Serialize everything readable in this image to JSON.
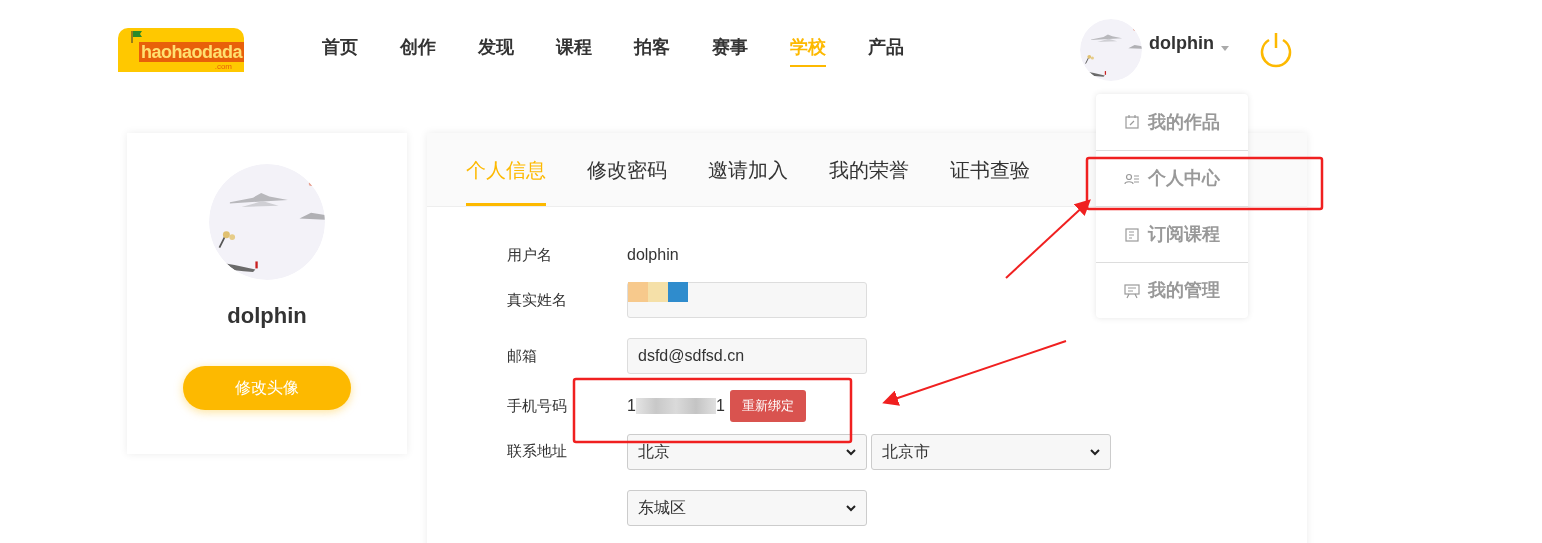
{
  "logo": {
    "text": "haohaodada",
    "suffix": ".com"
  },
  "nav": [
    {
      "label": "首页",
      "selected": false
    },
    {
      "label": "创作",
      "selected": false
    },
    {
      "label": "发现",
      "selected": false
    },
    {
      "label": "课程",
      "selected": false
    },
    {
      "label": "拍客",
      "selected": false
    },
    {
      "label": "赛事",
      "selected": false
    },
    {
      "label": "学校",
      "selected": true
    },
    {
      "label": "产品",
      "selected": false
    }
  ],
  "user": {
    "name": "dolphin"
  },
  "user_menu": {
    "expanded": true,
    "items": [
      {
        "label": "我的作品",
        "kind": "works",
        "selected": false
      },
      {
        "label": "个人中心",
        "kind": "profile",
        "selected": false
      },
      {
        "label": "订阅课程",
        "kind": "courses",
        "selected": false
      },
      {
        "label": "我的管理",
        "kind": "manage",
        "selected": false
      }
    ]
  },
  "profile_card": {
    "name": "dolphin",
    "button": "修改头像"
  },
  "tabs": [
    {
      "label": "个人信息",
      "selected": true
    },
    {
      "label": "修改密码",
      "selected": false
    },
    {
      "label": "邀请加入",
      "selected": false
    },
    {
      "label": "我的荣誉",
      "selected": false
    },
    {
      "label": "证书查验",
      "selected": false
    }
  ],
  "form": {
    "username": {
      "label": "用户名",
      "value": "dolphin"
    },
    "real_name": {
      "label": "真实姓名"
    },
    "email": {
      "label": "邮箱",
      "value": "dsfd@sdfsd.cn"
    },
    "phone": {
      "label": "手机号码",
      "start": "1",
      "end": "1",
      "button": "重新绑定"
    },
    "address": {
      "label": "联系地址",
      "province": "北京",
      "city": "北京市",
      "district": "东城区"
    }
  }
}
